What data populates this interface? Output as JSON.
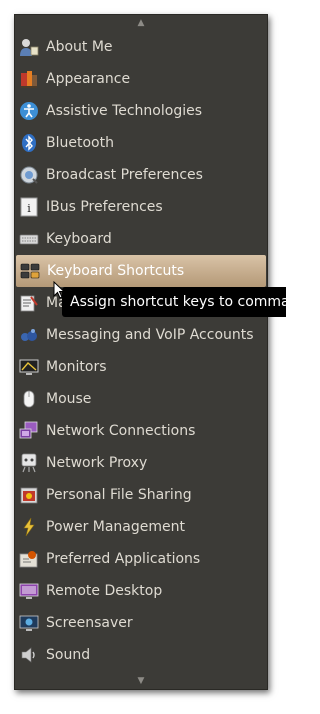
{
  "menu": {
    "scroll_up_glyph": "▲",
    "scroll_down_glyph": "▼",
    "items": [
      {
        "label": "About Me",
        "icon": "user-icon"
      },
      {
        "label": "Appearance",
        "icon": "appearance-icon"
      },
      {
        "label": "Assistive Technologies",
        "icon": "accessibility-icon"
      },
      {
        "label": "Bluetooth",
        "icon": "bluetooth-icon"
      },
      {
        "label": "Broadcast Preferences",
        "icon": "broadcast-icon"
      },
      {
        "label": "IBus Preferences",
        "icon": "ibus-icon"
      },
      {
        "label": "Keyboard",
        "icon": "keyboard-icon"
      },
      {
        "label": "Keyboard Shortcuts",
        "icon": "keyboard-shortcuts-icon",
        "highlighted": true
      },
      {
        "label": "Ma",
        "icon": "main-menu-icon"
      },
      {
        "label": "Messaging and VoIP Accounts",
        "icon": "messaging-icon"
      },
      {
        "label": "Monitors",
        "icon": "monitor-icon"
      },
      {
        "label": "Mouse",
        "icon": "mouse-icon"
      },
      {
        "label": "Network Connections",
        "icon": "network-connections-icon"
      },
      {
        "label": "Network Proxy",
        "icon": "network-proxy-icon"
      },
      {
        "label": "Personal File Sharing",
        "icon": "file-sharing-icon"
      },
      {
        "label": "Power Management",
        "icon": "power-icon"
      },
      {
        "label": "Preferred Applications",
        "icon": "preferred-apps-icon"
      },
      {
        "label": "Remote Desktop",
        "icon": "remote-desktop-icon"
      },
      {
        "label": "Screensaver",
        "icon": "screensaver-icon"
      },
      {
        "label": "Sound",
        "icon": "sound-icon"
      }
    ]
  },
  "tooltip": {
    "text": "Assign shortcut keys to comma"
  },
  "colors": {
    "menu_background": "#3c3b37",
    "menu_text": "#dfdbd2",
    "highlight": "#c9b08f",
    "tooltip_background": "#000000"
  }
}
